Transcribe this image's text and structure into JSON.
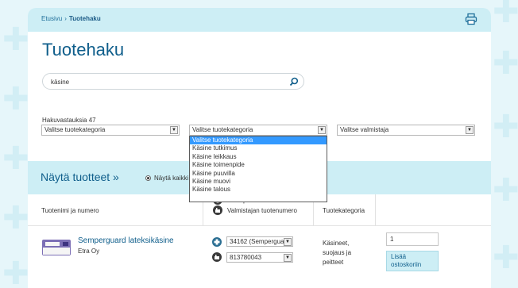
{
  "breadcrumb": {
    "home": "Etusivu",
    "separator": "›",
    "current": "Tuotehaku"
  },
  "page_title": "Tuotehaku",
  "search": {
    "value": "käsine"
  },
  "results_label": "Hakuvastauksia 47",
  "filters": {
    "category1": "Valitse tuotekategoria",
    "category2": "Valitse tuotekategoria",
    "manufacturer": "Valitse valmistaja"
  },
  "dropdown_options": [
    "Valitse tuotekategoria",
    "Käsine tutkimus",
    "Käsine leikkaus",
    "Käsine toimenpide",
    "Käsine puuvilla",
    "Käsine muovi",
    "Käsine talous"
  ],
  "showbar": {
    "title": "Näytä tuotteet »",
    "radio_label": "Näytä kaikki"
  },
  "columns": {
    "product": "Tuotenimi ja numero",
    "medigin_code": "Mediqin tuotenumero",
    "maker_code": "Valmistajan tuotenumero",
    "category": "Tuotekategoria"
  },
  "product": {
    "name": "Semperguard lateksikäsine",
    "maker": "Etra Oy",
    "medigin_code": "34162 (Semperguard",
    "maker_code": "813780043",
    "category": "Käsineet, suojaus ja peitteet",
    "quantity": "1",
    "add_button": "Lisää ostoskoriin"
  },
  "colors": {
    "accent": "#0f5e8b",
    "band": "#cdeef5",
    "background": "#e6f6fa",
    "selected": "#3399ff"
  }
}
